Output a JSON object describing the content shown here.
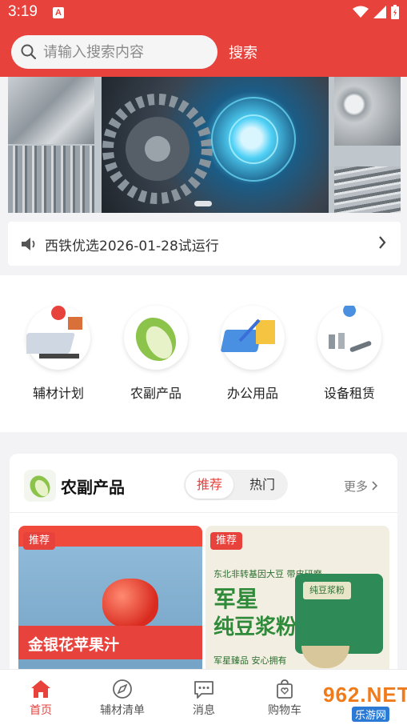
{
  "status_bar": {
    "time": "3:19",
    "notification_letter": "A"
  },
  "search": {
    "placeholder": "请输入搜索内容",
    "value": "",
    "button_label": "搜索"
  },
  "notice": {
    "text": "西铁优选2026-01-28试运行"
  },
  "categories": [
    {
      "label": "辅材计划",
      "icon": "map-plan-icon"
    },
    {
      "label": "农副产品",
      "icon": "cabbage-icon"
    },
    {
      "label": "办公用品",
      "icon": "office-supplies-icon"
    },
    {
      "label": "设备租赁",
      "icon": "equipment-rental-icon"
    }
  ],
  "section": {
    "title": "农副产品",
    "tabs": [
      "推荐",
      "热门"
    ],
    "active_tab": "推荐",
    "more_label": "更多",
    "products": [
      {
        "tag": "推荐",
        "box_text": "金银花苹果汁"
      },
      {
        "tag": "推荐",
        "subtitle": "东北非转基因大豆 带皮研磨",
        "title_line1": "军星",
        "title_line2": "纯豆浆粉",
        "slogan": "军星臻品 安心拥有",
        "bag_label": "纯豆浆粉"
      }
    ]
  },
  "bottom_nav": [
    {
      "label": "首页",
      "icon": "home-icon",
      "active": true
    },
    {
      "label": "辅材清单",
      "icon": "compass-icon",
      "active": false
    },
    {
      "label": "消息",
      "icon": "message-icon",
      "active": false
    },
    {
      "label": "购物车",
      "icon": "shopping-bag-icon",
      "active": false
    }
  ],
  "watermark": {
    "number": "962.NET",
    "sub": "乐游网"
  },
  "colors": {
    "brand_red": "#e8423d",
    "page_bg": "#f3f3f5"
  }
}
